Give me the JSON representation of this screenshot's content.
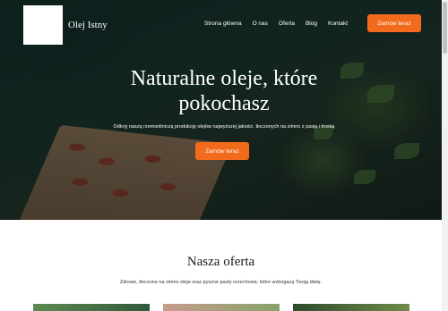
{
  "header": {
    "brand": "Olej Istny",
    "nav": [
      "Strona główna",
      "O nas",
      "Oferta",
      "Blog",
      "Kontakt"
    ],
    "cta": "Zamów teraz"
  },
  "hero": {
    "title_line1": "Naturalne oleje, które",
    "title_line2": "pokochasz",
    "subtitle": "Odkryj naszą rzemieślniczą produkcję olejów najwyższej jakości, tłoczonych na zimno z pasją i troską",
    "cta": "Zamów teraz"
  },
  "offer": {
    "title": "Nasza oferta",
    "subtitle": "Zdrowe, tłoczone na zimno oleje oraz pyszne pasty orzechowe, które wzbogacą Twoją dietę."
  },
  "colors": {
    "accent": "#f26a1b",
    "hero_overlay": "#1c3b34"
  }
}
